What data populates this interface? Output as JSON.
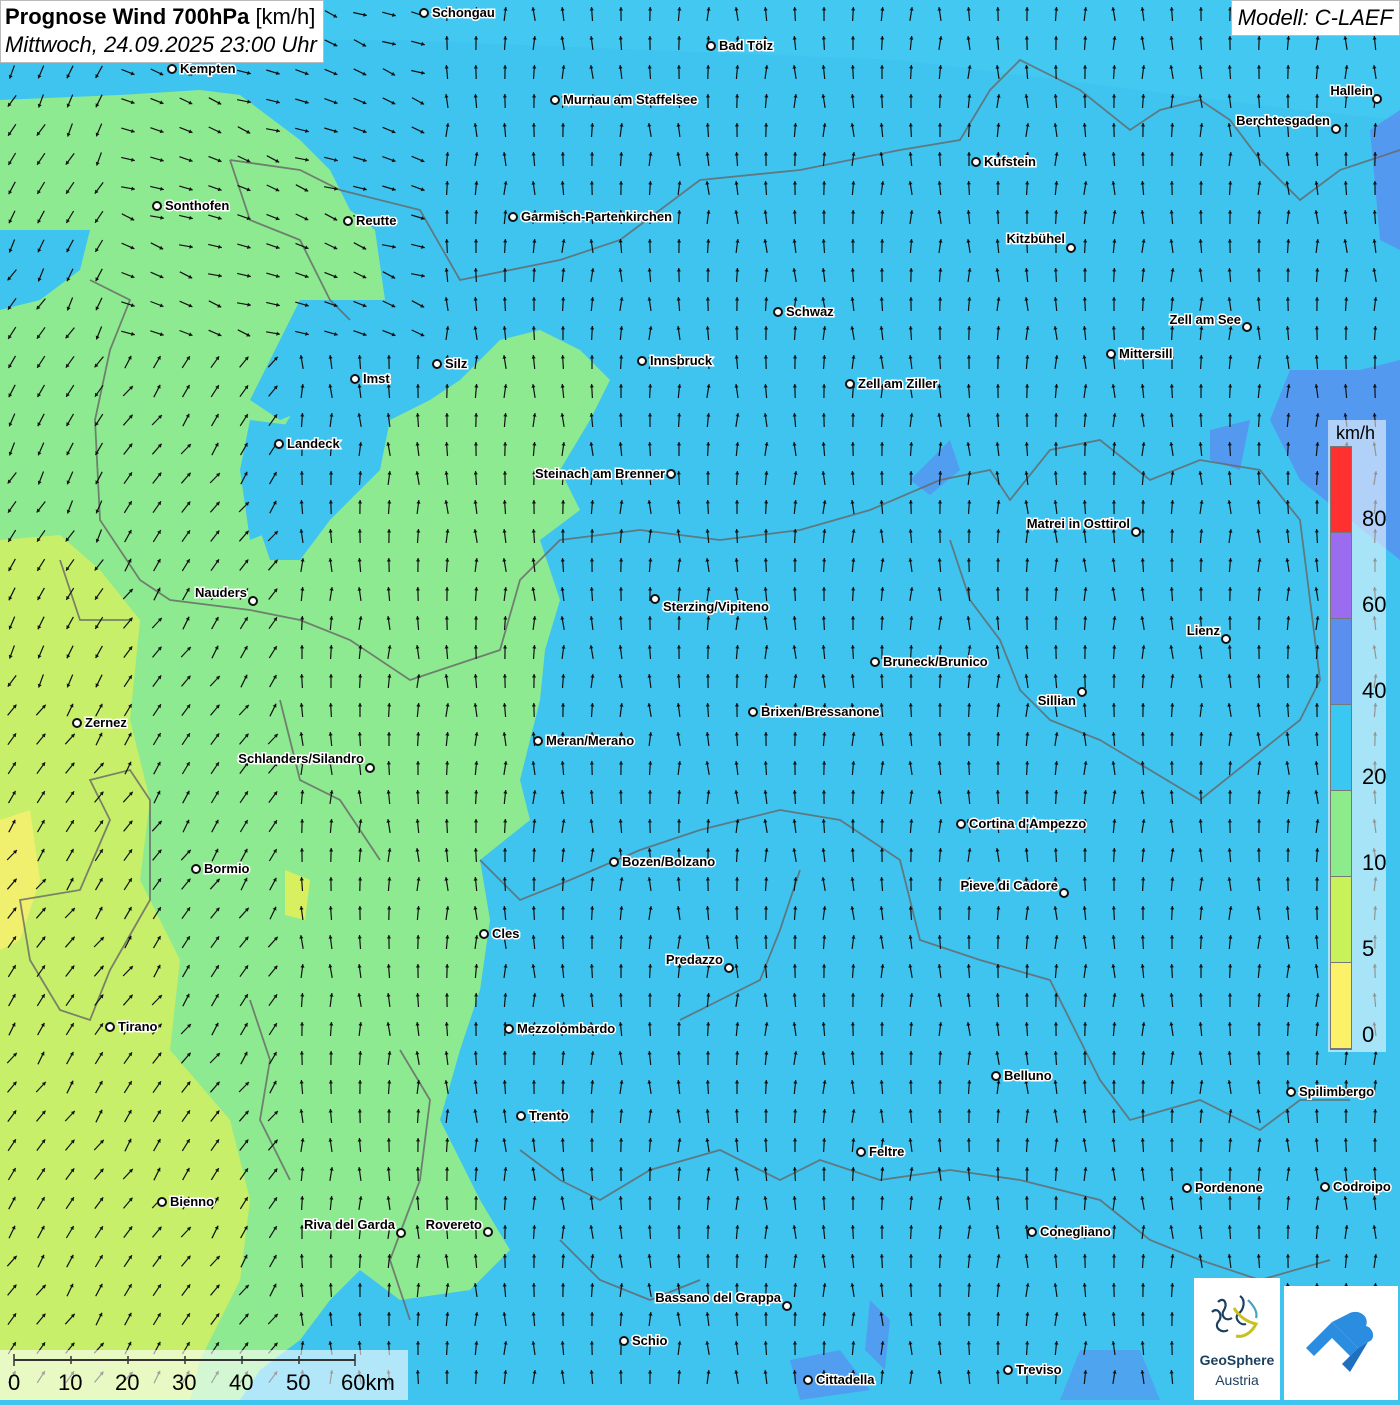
{
  "header": {
    "title": "Prognose Wind 700hPa",
    "unit": "[km/h]",
    "datetime": "Mittwoch, 24.09.2025 23:00 Uhr"
  },
  "model": "Modell: C-LAEF",
  "legend": {
    "unit": "km/h",
    "ticks": [
      "80",
      "60",
      "40",
      "20",
      "10",
      "5",
      "0"
    ],
    "colors": [
      "#ff3030",
      "#9a6cf0",
      "#5a8ff0",
      "#39c8f2",
      "#8cec8c",
      "#c8f25a",
      "#fbf26a"
    ]
  },
  "scalebar": {
    "ticks": [
      "0",
      "10",
      "20",
      "30",
      "40",
      "50",
      "60km"
    ]
  },
  "places": [
    {
      "name": "Schongau"
    },
    {
      "name": "Bad Tölz"
    },
    {
      "name": "Kempten"
    },
    {
      "name": "Murnau am Staffelsee"
    },
    {
      "name": "Hallein"
    },
    {
      "name": "Berchtesgaden"
    },
    {
      "name": "Kufstein"
    },
    {
      "name": "Sonthofen"
    },
    {
      "name": "Reutte"
    },
    {
      "name": "Garmisch-Partenkirchen"
    },
    {
      "name": "Kitzbühel"
    },
    {
      "name": "Schwaz"
    },
    {
      "name": "Zell am See"
    },
    {
      "name": "Mittersill"
    },
    {
      "name": "Innsbruck"
    },
    {
      "name": "Silz"
    },
    {
      "name": "Imst"
    },
    {
      "name": "Zell am Ziller"
    },
    {
      "name": "Landeck"
    },
    {
      "name": "Steinach am Brenner"
    },
    {
      "name": "Matrei in Osttirol"
    },
    {
      "name": "Nauders"
    },
    {
      "name": "Sterzing/Vipiteno"
    },
    {
      "name": "Lienz"
    },
    {
      "name": "Bruneck/Brunico"
    },
    {
      "name": "Sillian"
    },
    {
      "name": "Brixen/Bressanone"
    },
    {
      "name": "Zernez"
    },
    {
      "name": "Meran/Merano"
    },
    {
      "name": "Schlanders/Silandro"
    },
    {
      "name": "Cortina d'Ampezzo"
    },
    {
      "name": "Bozen/Bolzano"
    },
    {
      "name": "Bormio"
    },
    {
      "name": "Pieve di Cadore"
    },
    {
      "name": "Cles"
    },
    {
      "name": "Predazzo"
    },
    {
      "name": "Tirano"
    },
    {
      "name": "Mezzolombardo"
    },
    {
      "name": "Belluno"
    },
    {
      "name": "Spilimbergo"
    },
    {
      "name": "Trento"
    },
    {
      "name": "Feltre"
    },
    {
      "name": "Pordenone"
    },
    {
      "name": "Codroipo"
    },
    {
      "name": "Bienno"
    },
    {
      "name": "Riva del Garda"
    },
    {
      "name": "Rovereto"
    },
    {
      "name": "Conegliano"
    },
    {
      "name": "Bassano del Grappa"
    },
    {
      "name": "Schio"
    },
    {
      "name": "Treviso"
    },
    {
      "name": "Cittadella"
    }
  ],
  "logos": {
    "geosphere_line1": "GeoSphere",
    "geosphere_line2": "Austria"
  }
}
